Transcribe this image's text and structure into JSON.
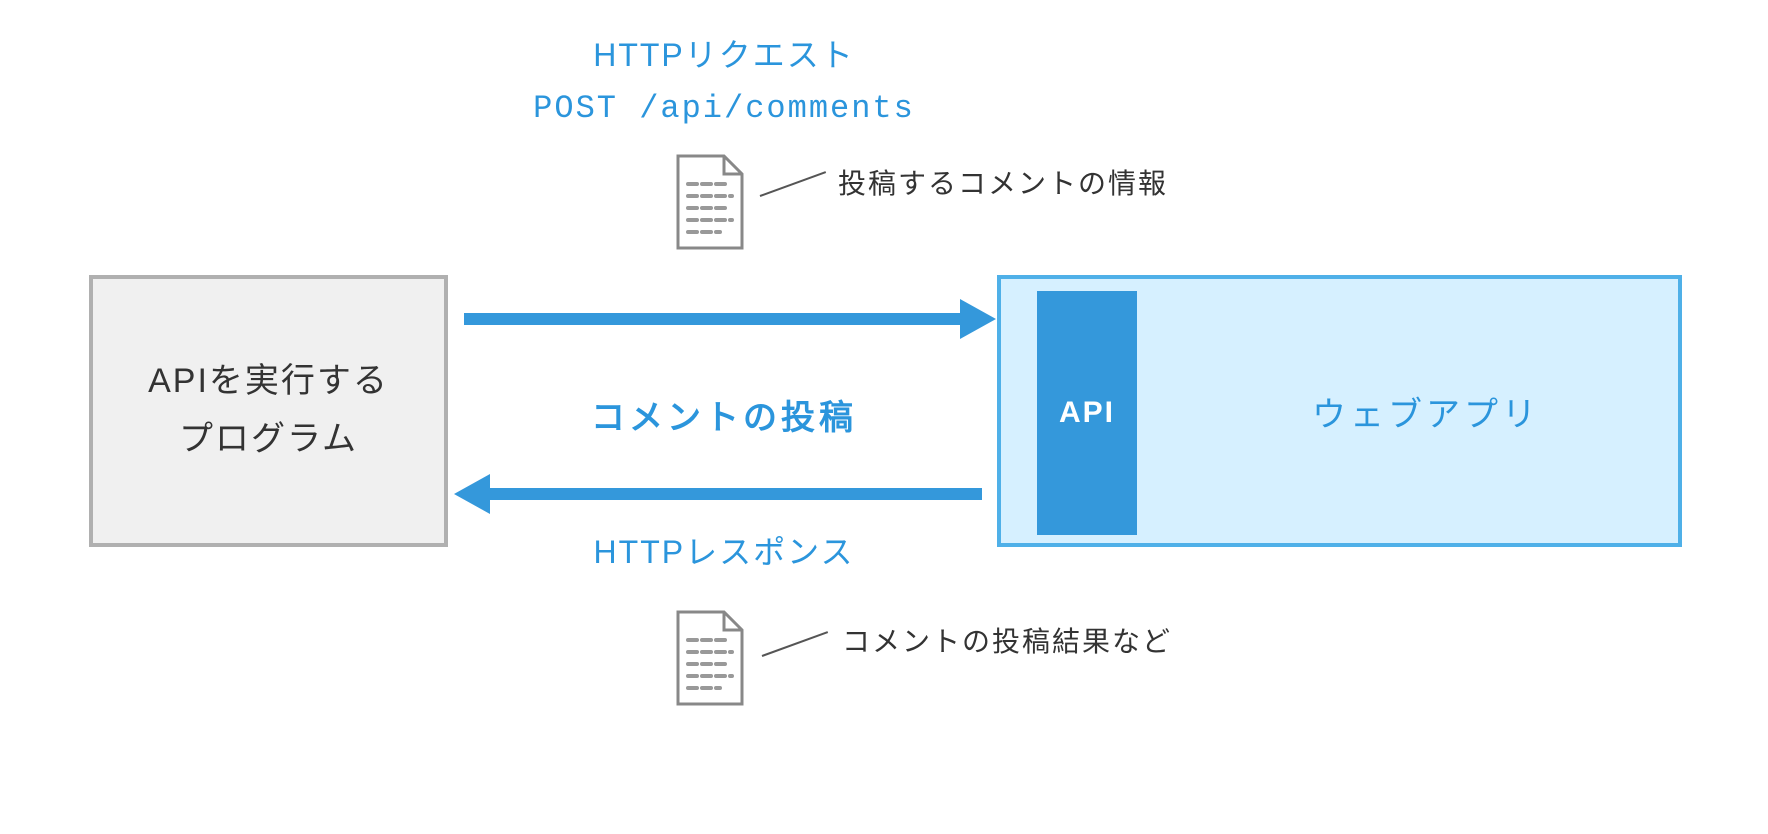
{
  "left_box": {
    "line1": "APIを実行する",
    "line2": "プログラム"
  },
  "right_box": {
    "api_badge": "API",
    "label": "ウェブアプリ"
  },
  "labels": {
    "request_title": "HTTPリクエスト",
    "endpoint": "POST /api/comments",
    "center_action": "コメントの投稿",
    "response_title": "HTTPレスポンス",
    "request_note": "投稿するコメントの情報",
    "response_note": "コメントの投稿結果など"
  }
}
